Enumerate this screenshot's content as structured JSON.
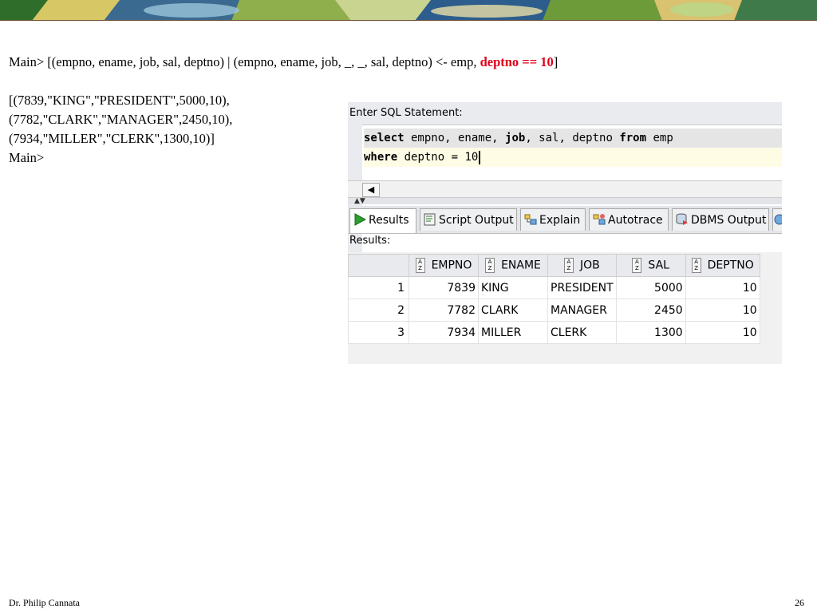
{
  "slide": {
    "command": {
      "prompt": "Main>",
      "text_before": " [(empno, ename, job, sal, deptno) | (empno, ename, job, _, _, sal, deptno) <- emp, ",
      "highlight": "deptno == 10",
      "text_after": "]"
    },
    "output_lines": [
      "[(7839,\"KING\",\"PRESIDENT\",5000,10),",
      "(7782,\"CLARK\",\"MANAGER\",2450,10),",
      "(7934,\"MILLER\",\"CLERK\",1300,10)]"
    ],
    "final_prompt": "Main>",
    "author": "Dr. Philip Cannata",
    "page_number": "26",
    "highlight_color": "#e0001b"
  },
  "sql_window": {
    "editor_label": "Enter SQL Statement:",
    "line1": {
      "kw1": "select",
      "part1": " empno, ename, ",
      "kw2": "job",
      "part2": ", sal, deptno ",
      "kw3": "from",
      "part3": " emp"
    },
    "line2": {
      "kw": "where",
      "rest": " deptno = 10"
    },
    "tabs": [
      {
        "label": "Results",
        "icon": "play-icon"
      },
      {
        "label": "Script Output",
        "icon": "script-icon"
      },
      {
        "label": "Explain",
        "icon": "explain-icon"
      },
      {
        "label": "Autotrace",
        "icon": "autotrace-icon"
      },
      {
        "label": "DBMS Output",
        "icon": "dbms-icon"
      }
    ],
    "results_label": "Results:",
    "columns": [
      "EMPNO",
      "ENAME",
      "JOB",
      "SAL",
      "DEPTNO"
    ],
    "rows": [
      {
        "n": "1",
        "empno": "7839",
        "ename": "KING",
        "job": "PRESIDENT",
        "sal": "5000",
        "deptno": "10"
      },
      {
        "n": "2",
        "empno": "7782",
        "ename": "CLARK",
        "job": "MANAGER",
        "sal": "2450",
        "deptno": "10"
      },
      {
        "n": "3",
        "empno": "7934",
        "ename": "MILLER",
        "job": "CLERK",
        "sal": "1300",
        "deptno": "10"
      }
    ]
  }
}
